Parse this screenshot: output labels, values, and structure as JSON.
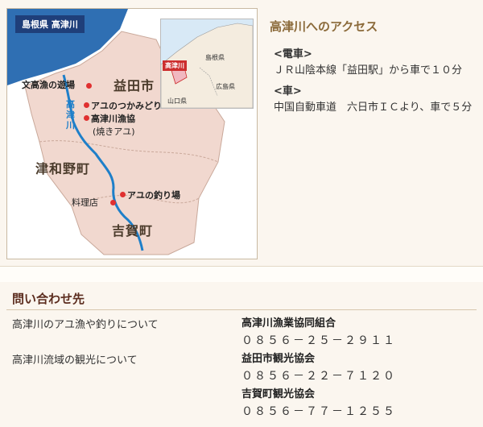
{
  "map": {
    "tag": "島根県 高津川",
    "inset": {
      "region": "高津川",
      "prefecture": "島根県",
      "neighbor_east": "広島県",
      "neighbor_south": "山口県"
    },
    "towns": {
      "masuda": "益田市",
      "tsuwano": "津和野町",
      "yoshika": "吉賀町"
    },
    "river_label": "高津川",
    "points": {
      "bunkougyo": "文高漁の遊場",
      "ayu_tsukami": "アユのつかみどり",
      "gyokyo": "高津川漁協",
      "gyokyo_sub": "(焼きアユ)",
      "tsuriba": "アユの釣り場",
      "ryoriten": "料理店"
    },
    "colors": {
      "sea": "#2f6fb3",
      "land": "#f1d8cf",
      "river": "#1e7fc9",
      "marker": "#e03030"
    }
  },
  "access": {
    "title": "高津川へのアクセス",
    "train_head": "<電車>",
    "train_text": "ＪＲ山陰本線「益田駅」から車で１０分",
    "car_head": "<車>",
    "car_text": "中国自動車道　六日市ＩＣより、車で５分"
  },
  "contact": {
    "title": "問い合わせ先",
    "q1": "高津川のアユ漁や釣りについて",
    "q2": "高津川流域の観光について",
    "org1": "高津川漁業協同組合",
    "phone1": "０８５６－２５－２９１１",
    "org2": "益田市観光協会",
    "phone2": "０８５６－２２－７１２０",
    "org3": "吉賀町観光協会",
    "phone3": "０８５６－７７－１２５５"
  }
}
